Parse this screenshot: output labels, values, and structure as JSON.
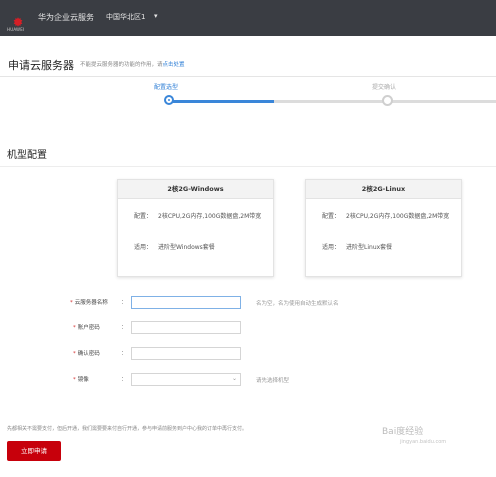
{
  "topbar": {
    "logo_caption": "HUAWEI",
    "brand": "华为企业云服务",
    "region": "中国华北区1",
    "region_caret": "▾"
  },
  "header": {
    "title": "申请云服务器",
    "notice_prefix": "不能提云服务器的功能的作用，请",
    "notice_link": "点击处置"
  },
  "steps": [
    {
      "label": "配置选型",
      "state": "active"
    },
    {
      "label": "提交确认",
      "state": "pending"
    }
  ],
  "progress": 0.33,
  "section": {
    "title": "机型配置"
  },
  "cards": [
    {
      "name": "2核2G-Windows",
      "spec_label": "配置：",
      "spec_value": "2核CPU,2G内存,100G数据盘,2M带宽",
      "use_label": "适用：",
      "use_value": "进阶型Windows套餐"
    },
    {
      "name": "2核2G-Linux",
      "spec_label": "配置：",
      "spec_value": "2核CPU,2G内存,100G数据盘,2M带宽",
      "use_label": "适用：",
      "use_value": "进阶型Linux套餐"
    }
  ],
  "form": {
    "star": "*",
    "colon": "：",
    "fields": [
      {
        "label": "云服务器名称",
        "value": "",
        "hint": "名为空，名为使用自动生成默认名"
      },
      {
        "label": "账户密码",
        "value": ""
      },
      {
        "label": "确认密码",
        "value": ""
      },
      {
        "label": "镜像",
        "value": "",
        "hint": "请先选择机型"
      }
    ]
  },
  "footer": {
    "note": "先都相关不需要支付，但后开通，我们需要要来付自行开通，参与申请前服务到户中心我的订单中再行支付。",
    "apply_label": "立即申请"
  },
  "watermark": {
    "text": "Bai度经验",
    "sub": "jingyan.baidu.com"
  },
  "colors": {
    "accent": "#3a86d9",
    "brand_red": "#c7000b",
    "topbar": "#3a3d43"
  }
}
